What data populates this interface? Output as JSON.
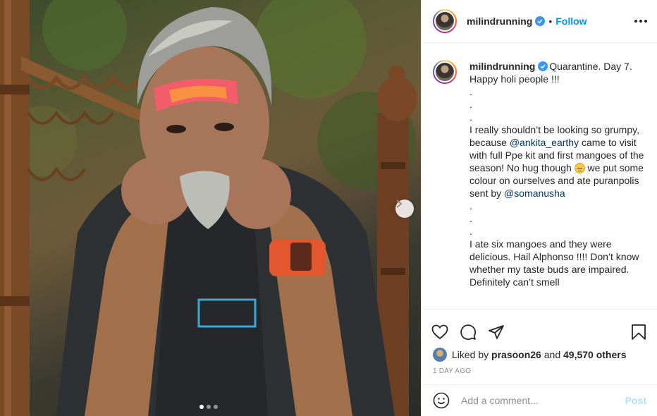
{
  "post": {
    "username": "milindrunning",
    "follow_label": "Follow",
    "separator": "•",
    "caption_head": "Quarantine. Day 7.\nHappy holi people !!!\n.\n.\n.\nI really shouldn’t be looking so grumpy, because ",
    "mention_1": "@ankita_earthy",
    "caption_mid": " came to visit with full Ppe kit and first mangoes of the season! No hug though ",
    "emoji": "disappointed-face-emoji",
    "caption_mid2": " we put some colour on ourselves and ate puranpolis sent by ",
    "mention_2": "@somanusha",
    "caption_tail": "\n.\n.\n.\nI ate six mangoes and they were delicious. Hail Alphonso !!!! Don’t know whether my taste buds are impaired. Definitely can’t smell",
    "liked_by_prefix": "Liked by ",
    "liked_by_user": "prasoon26",
    "liked_by_mid": " and ",
    "likes_count": "49,570 others",
    "time_ago": "1 DAY AGO",
    "comment_placeholder": "Add a comment...",
    "post_button": "Post",
    "carousel": {
      "slides": 3,
      "active": 1
    }
  },
  "icons": {
    "verified": "verified-badge-icon",
    "more": "more-options-icon",
    "like": "heart-icon",
    "comment": "comment-bubble-icon",
    "share": "paper-plane-icon",
    "save": "bookmark-icon",
    "emoji": "smiley-icon",
    "next": "chevron-right-icon"
  },
  "colors": {
    "accent": "#0095f6",
    "verified": "#3897f0",
    "post_disabled": "#b2dffc",
    "text": "#262626",
    "muted": "#8e8e8e",
    "mention": "#00376b"
  }
}
